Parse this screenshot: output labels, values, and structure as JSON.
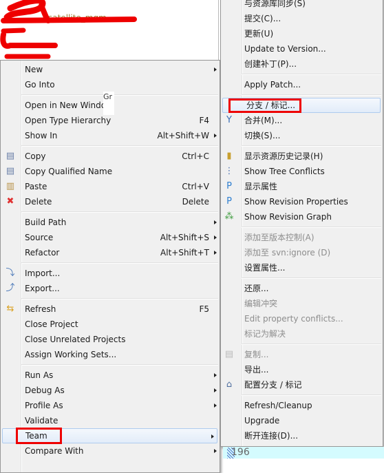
{
  "background": {
    "tree_fragment": "satellite_mgm",
    "redacted_color": "#ee0000",
    "overlay_fragment": "Gr",
    "line_number": "196"
  },
  "left_menu": [
    {
      "label": "New",
      "submenu": true
    },
    {
      "label": "Go Into"
    },
    {
      "sep": true
    },
    {
      "label": "Open in New Windo"
    },
    {
      "label": "Open Type Hierarchy",
      "shortcut": "F4"
    },
    {
      "label": "Show In",
      "shortcut": "Alt+Shift+W",
      "submenu": true
    },
    {
      "sep": true
    },
    {
      "label": "Copy",
      "shortcut": "Ctrl+C",
      "icon": "copy-icon"
    },
    {
      "label": "Copy Qualified Name",
      "icon": "copy-qualified-name-icon"
    },
    {
      "label": "Paste",
      "shortcut": "Ctrl+V",
      "icon": "paste-icon"
    },
    {
      "label": "Delete",
      "shortcut": "Delete",
      "icon": "delete-icon"
    },
    {
      "sep": true
    },
    {
      "label": "Build Path",
      "submenu": true
    },
    {
      "label": "Source",
      "shortcut": "Alt+Shift+S",
      "submenu": true
    },
    {
      "label": "Refactor",
      "shortcut": "Alt+Shift+T",
      "submenu": true
    },
    {
      "sep": true
    },
    {
      "label": "Import...",
      "icon": "import-icon"
    },
    {
      "label": "Export...",
      "icon": "export-icon"
    },
    {
      "sep": true
    },
    {
      "label": "Refresh",
      "shortcut": "F5",
      "icon": "refresh-icon"
    },
    {
      "label": "Close Project"
    },
    {
      "label": "Close Unrelated Projects"
    },
    {
      "label": "Assign Working Sets..."
    },
    {
      "sep": true
    },
    {
      "label": "Run As",
      "submenu": true
    },
    {
      "label": "Debug As",
      "submenu": true
    },
    {
      "label": "Profile As",
      "submenu": true
    },
    {
      "label": "Validate"
    },
    {
      "label": "Team",
      "submenu": true,
      "highlighted": true,
      "annotated": true
    },
    {
      "label": "Compare With",
      "submenu": true
    }
  ],
  "right_menu": [
    {
      "label": "与资源库同步(S)"
    },
    {
      "label": "提交(C)..."
    },
    {
      "label": "更新(U)"
    },
    {
      "label": "Update to Version..."
    },
    {
      "label": "创建补丁(P)..."
    },
    {
      "sep": true
    },
    {
      "label": "Apply Patch..."
    },
    {
      "sep": true
    },
    {
      "label": "分支 / 标记...",
      "highlighted": true,
      "annotated": true
    },
    {
      "label": "合并(M)...",
      "icon": "merge-icon"
    },
    {
      "label": "切换(S)..."
    },
    {
      "sep": true
    },
    {
      "label": "显示资源历史记录(H)",
      "icon": "history-icon"
    },
    {
      "label": "Show Tree Conflicts",
      "icon": "tree-conflicts-icon"
    },
    {
      "label": "显示属性",
      "icon": "properties-icon"
    },
    {
      "label": "Show Revision Properties",
      "icon": "revision-properties-icon"
    },
    {
      "label": "Show Revision Graph",
      "icon": "revision-graph-icon"
    },
    {
      "sep": true
    },
    {
      "label": "添加至版本控制(A)",
      "disabled": true
    },
    {
      "label": "添加至 svn:ignore (D)",
      "disabled": true
    },
    {
      "label": "设置属性..."
    },
    {
      "sep": true
    },
    {
      "label": "还原..."
    },
    {
      "label": "编辑冲突",
      "disabled": true
    },
    {
      "label": "Edit property conflicts...",
      "disabled": true
    },
    {
      "label": "标记为解决",
      "disabled": true
    },
    {
      "sep": true
    },
    {
      "label": "复制...",
      "disabled": true,
      "icon": "copy-icon"
    },
    {
      "label": "导出..."
    },
    {
      "label": "配置分支 / 标记",
      "icon": "branch-config-icon"
    },
    {
      "sep": true
    },
    {
      "label": "Refresh/Cleanup"
    },
    {
      "label": "Upgrade"
    },
    {
      "label": "断开连接(D)..."
    }
  ]
}
